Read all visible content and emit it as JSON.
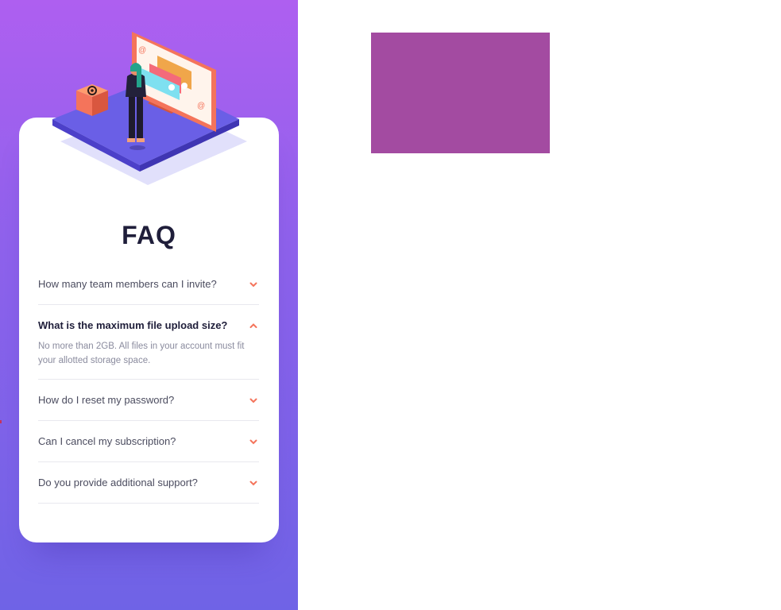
{
  "title": "FAQ",
  "faq": [
    {
      "question": "How many team members can I invite?",
      "answer": "",
      "open": false
    },
    {
      "question": "What is the maximum file upload size?",
      "answer": "No more than 2GB. All files in your account must fit your allotted storage space.",
      "open": true
    },
    {
      "question": "How do I reset my password?",
      "answer": "",
      "open": false
    },
    {
      "question": "Can I cancel my subscription?",
      "answer": "",
      "open": false
    },
    {
      "question": "Do you provide additional support?",
      "answer": "",
      "open": false
    }
  ],
  "colors": {
    "gradient_top": "#ae5ff0",
    "gradient_bottom": "#6f63e6",
    "accent": "#f4745b",
    "title": "#1f1e3a",
    "swatch": "#a34ba1"
  },
  "icons": {
    "chevron": "chevron-icon",
    "illustration": "woman-online-illustration",
    "box": "at-sign-box-icon"
  }
}
